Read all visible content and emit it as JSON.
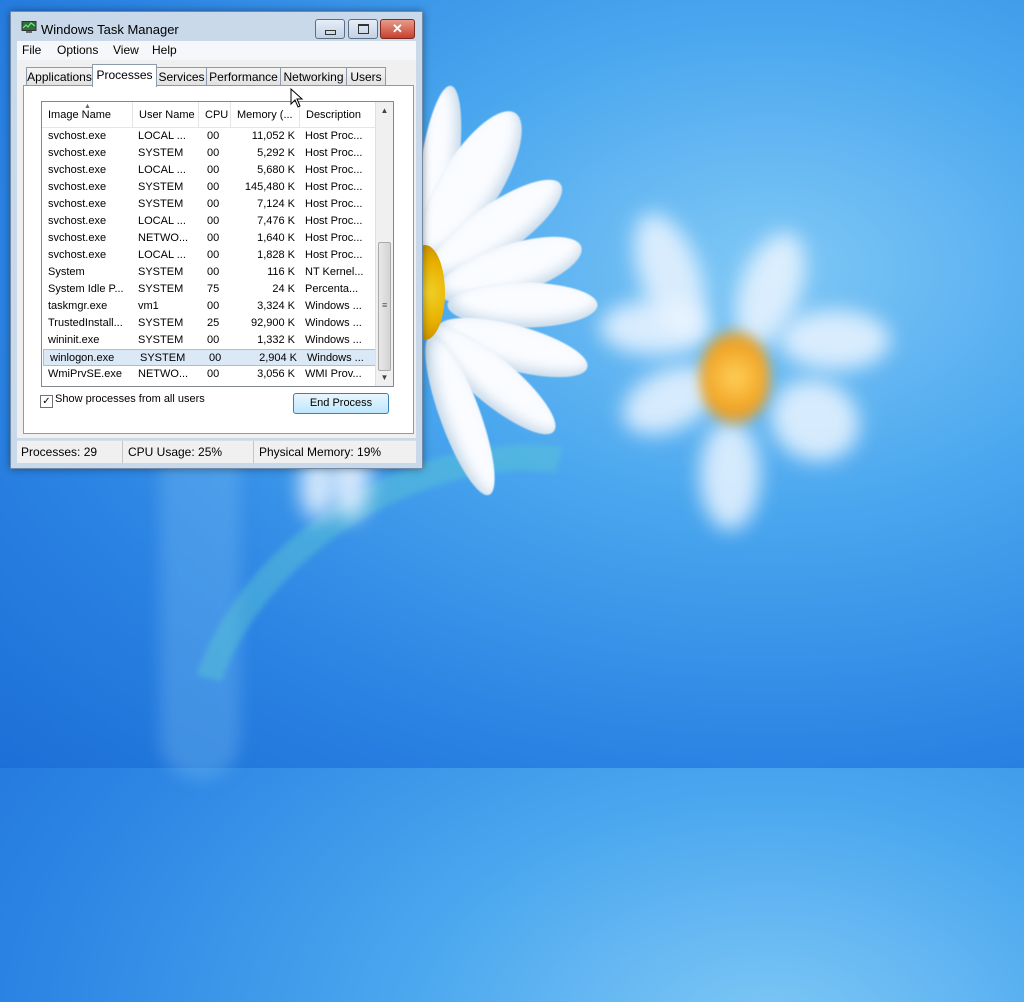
{
  "window": {
    "title": "Windows Task Manager",
    "caption_buttons": {
      "minimize": "minimize",
      "maximize": "maximize",
      "close": "✕"
    }
  },
  "menu": [
    "File",
    "Options",
    "View",
    "Help"
  ],
  "tabs": [
    "Applications",
    "Processes",
    "Services",
    "Performance",
    "Networking",
    "Users"
  ],
  "active_tab": "Processes",
  "processes": {
    "columns": [
      "Image Name",
      "User Name",
      "CPU",
      "Memory (...",
      "Description"
    ],
    "rows": [
      [
        "svchost.exe",
        "LOCAL ...",
        "00",
        "11,052 K",
        "Host Proc..."
      ],
      [
        "svchost.exe",
        "SYSTEM",
        "00",
        "5,292 K",
        "Host Proc..."
      ],
      [
        "svchost.exe",
        "LOCAL ...",
        "00",
        "5,680 K",
        "Host Proc..."
      ],
      [
        "svchost.exe",
        "SYSTEM",
        "00",
        "145,480 K",
        "Host Proc..."
      ],
      [
        "svchost.exe",
        "SYSTEM",
        "00",
        "7,124 K",
        "Host Proc..."
      ],
      [
        "svchost.exe",
        "LOCAL ...",
        "00",
        "7,476 K",
        "Host Proc..."
      ],
      [
        "svchost.exe",
        "NETWO...",
        "00",
        "1,640 K",
        "Host Proc..."
      ],
      [
        "svchost.exe",
        "LOCAL ...",
        "00",
        "1,828 K",
        "Host Proc..."
      ],
      [
        "System",
        "SYSTEM",
        "00",
        "116 K",
        "NT Kernel..."
      ],
      [
        "System Idle P...",
        "SYSTEM",
        "75",
        "24 K",
        "Percenta..."
      ],
      [
        "taskmgr.exe",
        "vm1",
        "00",
        "3,324 K",
        "Windows ..."
      ],
      [
        "TrustedInstall...",
        "SYSTEM",
        "25",
        "92,900 K",
        "Windows ..."
      ],
      [
        "wininit.exe",
        "SYSTEM",
        "00",
        "1,332 K",
        "Windows ..."
      ],
      [
        "winlogon.exe",
        "SYSTEM",
        "00",
        "2,904 K",
        "Windows ..."
      ],
      [
        "WmiPrvSE.exe",
        "NETWO...",
        "00",
        "3,056 K",
        "WMI Prov..."
      ]
    ],
    "selected_row": 13
  },
  "show_all_users": {
    "label": "Show processes from all users",
    "checked": true,
    "check_glyph": "✓"
  },
  "end_process_label": "End Process",
  "status": {
    "processes": "Processes: 29",
    "cpu": "CPU Usage: 25%",
    "memory": "Physical Memory: 19%"
  },
  "icons": {
    "sort": "▲",
    "scroll_up": "▲",
    "scroll_down": "▼",
    "grip": "≡"
  }
}
